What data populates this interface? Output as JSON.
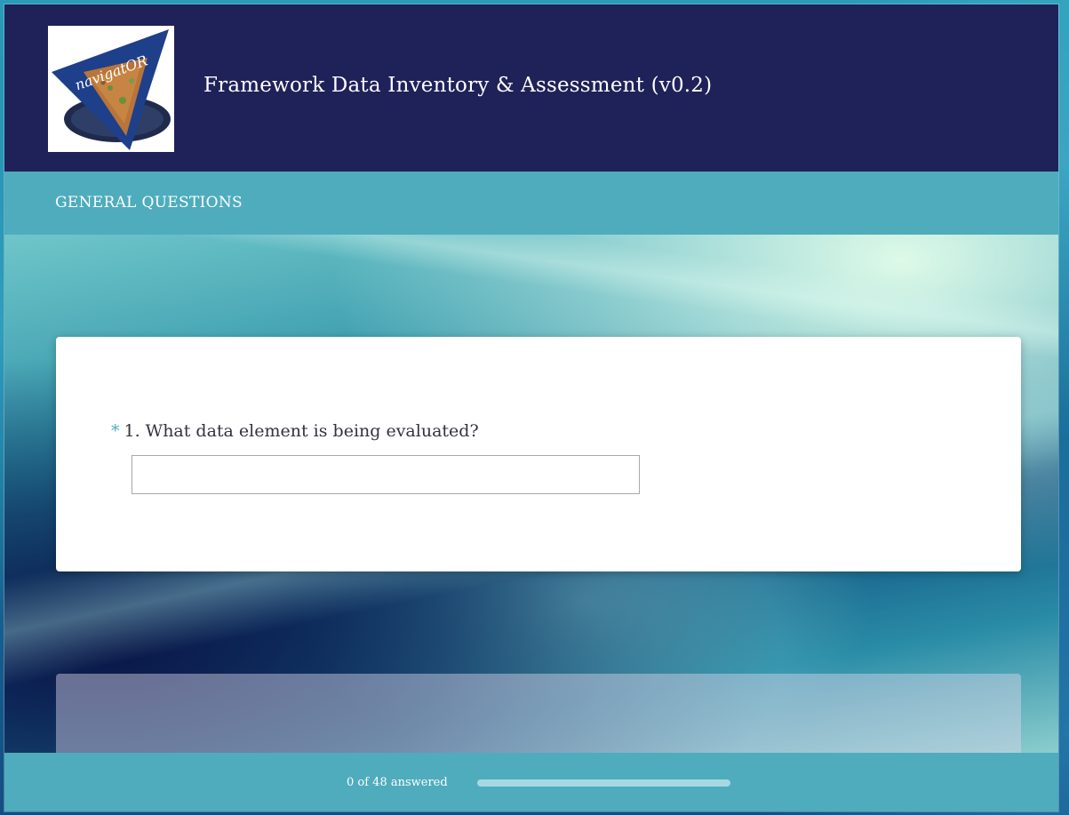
{
  "header": {
    "title": "Framework Data Inventory & Assessment (v0.2)",
    "logo_icon": "navigator-logo-icon",
    "logo_text": "navigatOR"
  },
  "section": {
    "title": "GENERAL QUESTIONS"
  },
  "question": {
    "required_marker": "*",
    "label": "1. What data element is being evaluated?",
    "answer_value": "",
    "answer_placeholder": ""
  },
  "progress": {
    "text": "0 of 48 answered",
    "answered": 0,
    "total": 48
  },
  "colors": {
    "header_bg": "#1f2159",
    "accent_teal": "#4eacbd",
    "progress_track": "#a6d8e2"
  }
}
